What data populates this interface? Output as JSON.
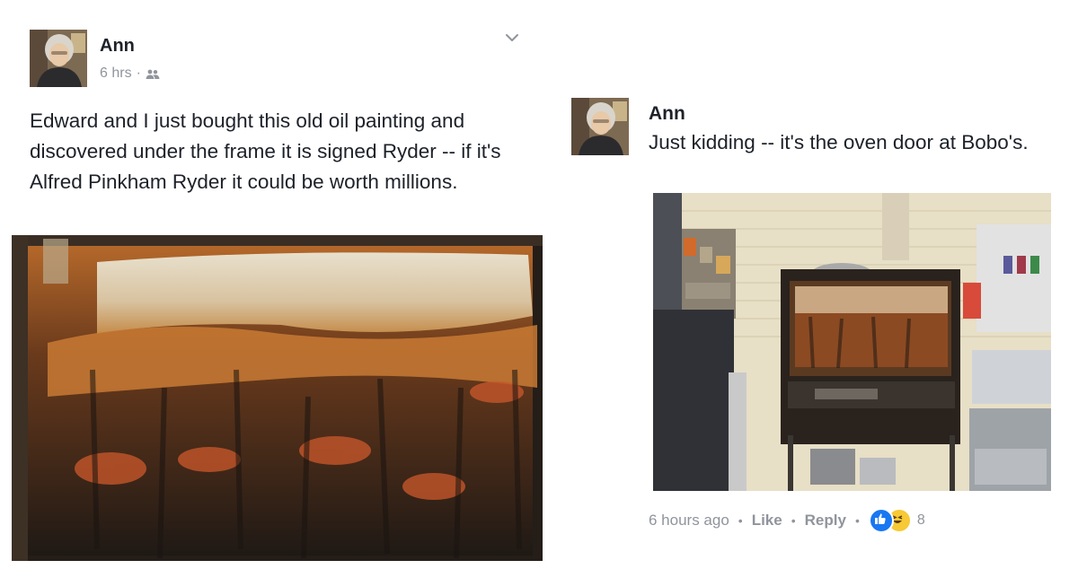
{
  "post": {
    "author": "Ann",
    "time": "6 hrs",
    "audience_icon": "friends-icon",
    "menu_icon": "chevron-down-icon",
    "text": "Edward and I just bought this old oil painting and discovered under the frame it is signed Ryder -- if it's Alfred Pinkham Ryder it could be worth millions.",
    "photo": "rusted-oven-door-photo"
  },
  "comment": {
    "author": "Ann",
    "text": "Just kidding -- it's the oven door at Bobo's.",
    "photo": "kitchen-oven-photo",
    "time": "6 hours ago",
    "like_label": "Like",
    "reply_label": "Reply",
    "reaction_icons": [
      "like-icon",
      "haha-icon"
    ],
    "reaction_count": "8"
  },
  "colors": {
    "text": "#1d2129",
    "meta": "#90949c",
    "like_blue": "#1877f2",
    "haha_yellow": "#f7c934"
  }
}
